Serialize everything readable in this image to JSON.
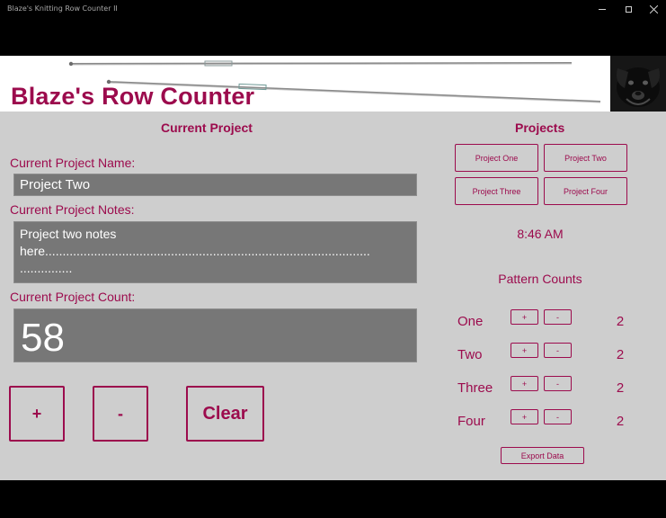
{
  "window": {
    "title": "Blaze's Knitting Row Counter II"
  },
  "header": {
    "app_title": "Blaze's Row Counter"
  },
  "current_project": {
    "section_title": "Current Project",
    "name_label": "Current Project Name:",
    "name_value": "Project Two",
    "notes_label": "Current Project Notes:",
    "notes_value": "Project two notes\nhere.............................................................................................\n...............",
    "count_label": "Current Project Count:",
    "count_value": "58",
    "plus_label": "+",
    "minus_label": "-",
    "clear_label": "Clear"
  },
  "projects": {
    "section_title": "Projects",
    "buttons": [
      "Project One",
      "Project Two",
      "Project Three",
      "Project Four"
    ]
  },
  "clock": "8:46 AM",
  "pattern_counts": {
    "title": "Pattern Counts",
    "rows": [
      {
        "label": "One",
        "plus": "+",
        "minus": "-",
        "value": "2"
      },
      {
        "label": "Two",
        "plus": "+",
        "minus": "-",
        "value": "2"
      },
      {
        "label": "Three",
        "plus": "+",
        "minus": "-",
        "value": "2"
      },
      {
        "label": "Four",
        "plus": "+",
        "minus": "-",
        "value": "2"
      }
    ]
  },
  "export_label": "Export Data",
  "colors": {
    "accent": "#9c0b4d",
    "background": "#cecece",
    "field": "#777777"
  }
}
